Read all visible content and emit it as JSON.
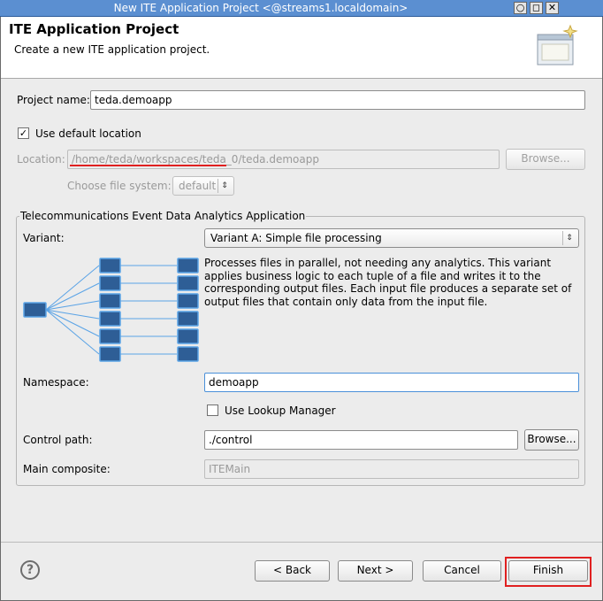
{
  "window": {
    "title": "New ITE Application Project  <@streams1.localdomain>",
    "controls": [
      "○",
      "◻",
      "✕"
    ]
  },
  "header": {
    "title": "ITE Application Project",
    "description": "Create a new ITE application project."
  },
  "project": {
    "name_label": "Project name:",
    "name_value": "teda.demoapp",
    "use_default_label": "Use default location",
    "use_default_checked": true,
    "location_label": "Location:",
    "location_value": "/home/teda/workspaces/teda_0/teda.demoapp",
    "browse_label": "Browse...",
    "filesystem_label": "Choose file system:",
    "filesystem_value": "default"
  },
  "group": {
    "title": "Telecommunications Event Data Analytics Application",
    "variant_label": "Variant:",
    "variant_value": "Variant A: Simple file processing",
    "description": "Processes files in parallel, not needing any analytics. This variant applies business logic to each tuple of a file and writes it to the corresponding output files. Each input file produces a separate set of output files that contain only data from the input file.",
    "namespace_label": "Namespace:",
    "namespace_value": "demoapp",
    "lookup_label": "Use Lookup Manager",
    "lookup_checked": false,
    "control_path_label": "Control path:",
    "control_path_value": "./control",
    "control_browse_label": "Browse...",
    "main_composite_label": "Main composite:",
    "main_composite_value": "ITEMain"
  },
  "footer": {
    "help_icon": "?",
    "back_label": "< Back",
    "next_label": "Next >",
    "cancel_label": "Cancel",
    "finish_label": "Finish"
  },
  "colors": {
    "titlebar": "#5b8fd1",
    "diagram_block": "#2e5e96",
    "diagram_border": "#5aa3e6",
    "highlight": "#e02020"
  }
}
